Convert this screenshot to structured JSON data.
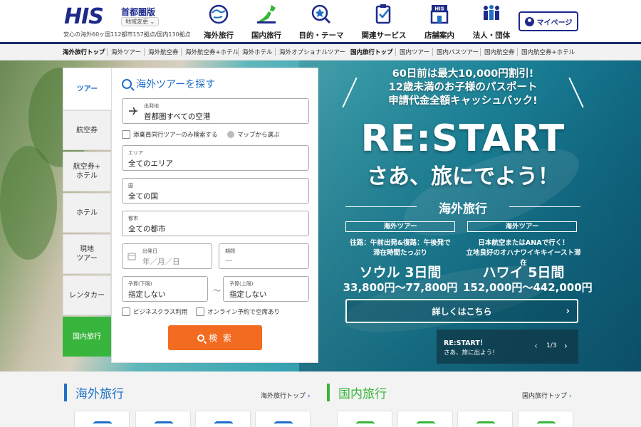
{
  "header": {
    "logo": "HIS",
    "region": "首都圏版",
    "region_change": "地域変更 ⌄",
    "tagline": "安心の海外60ヶ国112都市157拠点/国内130拠点",
    "nav": [
      {
        "label": "海外旅行",
        "icon": "globe-icon"
      },
      {
        "label": "国内旅行",
        "icon": "japan-map-icon"
      },
      {
        "label": "目的・テーマ",
        "icon": "magnifier-icon"
      },
      {
        "label": "関連サービス",
        "icon": "clipboard-icon"
      },
      {
        "label": "店舗案内",
        "icon": "store-icon"
      },
      {
        "label": "法人・団体",
        "icon": "group-icon"
      }
    ],
    "mypage": "マイページ"
  },
  "subnav": {
    "items": [
      "海外旅行トップ",
      "海外ツアー",
      "海外航空券",
      "海外航空券+ホテル",
      "海外ホテル",
      "海外オプショナルツアー",
      "国内旅行トップ",
      "国内ツアー",
      "国内バスツアー",
      "国内航空券",
      "国内航空券+ホテル"
    ]
  },
  "search": {
    "tabs": [
      "ツアー",
      "航空券",
      "航空券+\nホテル",
      "ホテル",
      "現地\nツアー",
      "レンタカー",
      "国内旅行"
    ],
    "title": "海外ツアーを探す",
    "departure_label": "出発地",
    "departure_value": "首都圏すべての空港",
    "chk_conductor": "添乗員同行ツアーのみ検索する",
    "map_link": "マップから選ぶ",
    "area_label": "エリア",
    "area_value": "全てのエリア",
    "country_label": "国",
    "country_value": "全ての国",
    "city_label": "都市",
    "city_value": "全ての都市",
    "date_label": "出発日",
    "date_placeholder": "年／月／日",
    "period_label": "期間",
    "period_value": "—",
    "budget_min_label": "予算(下限)",
    "budget_min_value": "指定しない",
    "budget_max_label": "予算(上限)",
    "budget_max_value": "指定しない",
    "tilde": "～",
    "chk_business": "ビジネスクラス利用",
    "chk_online": "オンライン予約で空席あり",
    "button": "検 索"
  },
  "promo": {
    "top_line1": "60日前は最大10,000円割引!",
    "top_line2": "12歳未満のお子様のパスポート",
    "top_line3": "申請代金全額キャッシュバック!",
    "headline": "RE:START",
    "subheadline": "さあ、旅にでよう！",
    "category": "海外旅行",
    "deals": [
      {
        "tag": "海外ツアー",
        "desc1": "往路：午前出発&復路：午後発で",
        "desc2": "滞在時間たっぷり",
        "city": "ソウル 3日間",
        "price": "33,800円～77,800円"
      },
      {
        "tag": "海外ツアー",
        "desc1": "日本航空またはANAで行く！",
        "desc2": "立地良好のオハナワイキキイースト滞在",
        "city": "ハワイ 5日間",
        "price": "152,000円～442,000円"
      }
    ],
    "detail_button": "詳しくはこちら",
    "carousel_title": "RE:START！",
    "carousel_sub": "さあ、旅に出よう！",
    "carousel_count": "1/3"
  },
  "bottom": {
    "overseas_title": "海外旅行",
    "overseas_link": "海外旅行トップ",
    "domestic_title": "国内旅行",
    "domestic_link": "国内旅行トップ"
  },
  "colors": {
    "brand": "#1d2a8a",
    "accent_blue": "#1e6fc8",
    "accent_green": "#38b53c",
    "search_orange": "#f36b21"
  }
}
